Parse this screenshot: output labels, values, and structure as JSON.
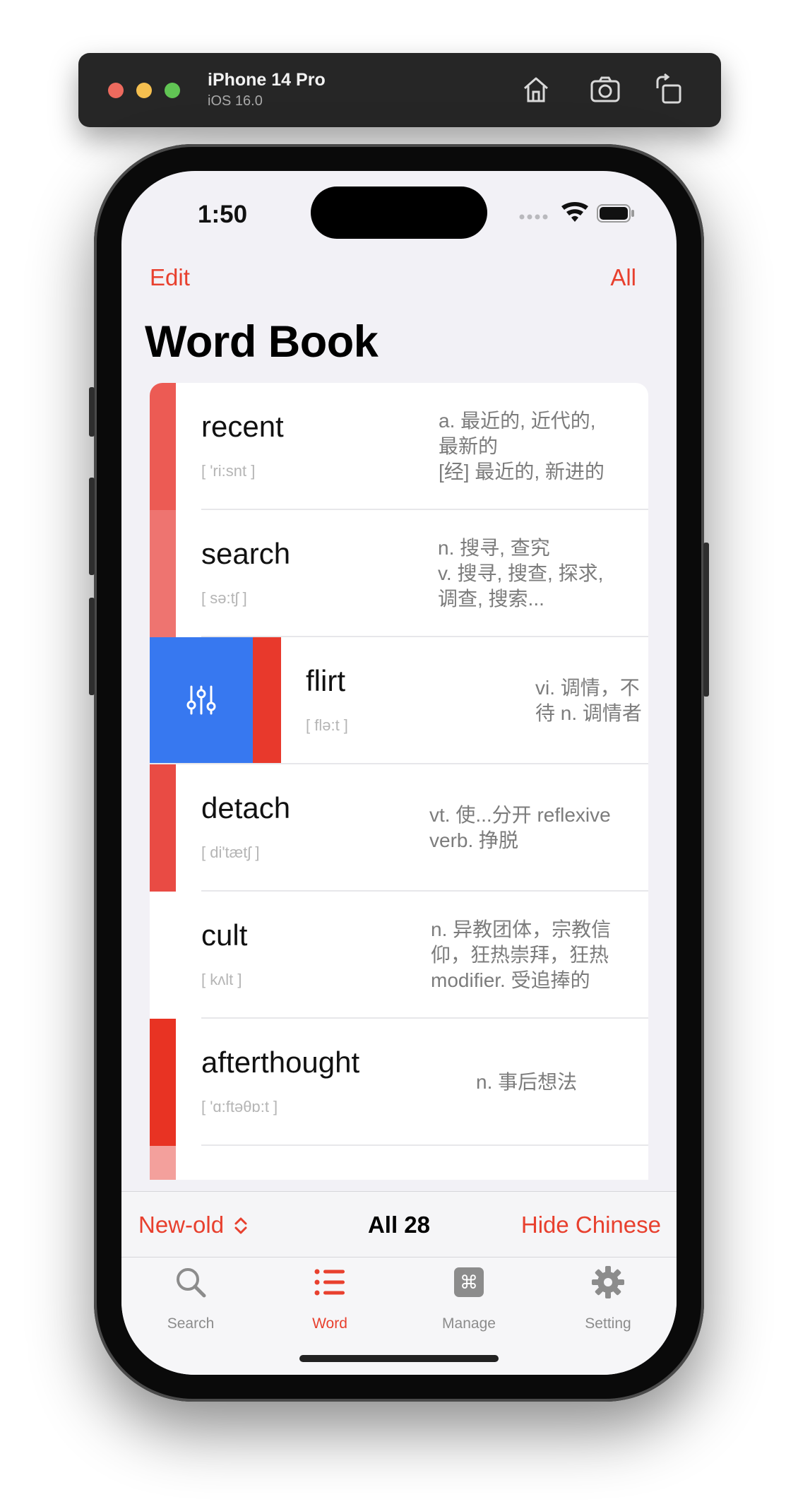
{
  "simulator": {
    "device_name": "iPhone 14 Pro",
    "os_version": "iOS 16.0"
  },
  "status_bar": {
    "time": "1:50"
  },
  "nav": {
    "edit_label": "Edit",
    "all_label": "All",
    "title": "Word Book"
  },
  "words": [
    {
      "word": "recent",
      "phonetic": "[ 'ri:snt ]",
      "meaning": "a. 最近的, 近代的,\n最新的\n[经] 最近的, 新进的",
      "color": "#ec5b54"
    },
    {
      "word": "search",
      "phonetic": "[ sə:tʃ ]",
      "meaning": "n. 搜寻, 查究\nv. 搜寻, 搜查, 探求,\n调查, 搜索...",
      "color": "#ee7470"
    },
    {
      "word": "flirt",
      "phonetic": "[ flə:t ]",
      "meaning": "vi. 调情，不\n待 n. 调情者",
      "color": "#e8392c"
    },
    {
      "word": "detach",
      "phonetic": "[ di'tætʃ ]",
      "meaning": "vt. 使...分开 reflexive\nverb. 挣脱",
      "color": "#e94b44"
    },
    {
      "word": "cult",
      "phonetic": "[ kʌlt ]",
      "meaning": "n. 异教团体，宗教信\n仰，狂热崇拜，狂热\nmodifier. 受追捧的",
      "color": "#ffffff"
    },
    {
      "word": "afterthought",
      "phonetic": "[ 'ɑ:ftəθɒ:t ]",
      "meaning": "n. 事后想法",
      "color": "#e83323"
    }
  ],
  "next_row_color": "#f3a09c",
  "swipe_action": {
    "icon": "sliders-icon",
    "color": "#3778f0"
  },
  "filter_bar": {
    "sort_label": "New-old",
    "count_label": "All 28",
    "hide_label": "Hide Chinese"
  },
  "tabs": [
    {
      "label": "Search",
      "icon": "search-icon",
      "active": false
    },
    {
      "label": "Word",
      "icon": "list-icon",
      "active": true
    },
    {
      "label": "Manage",
      "icon": "command-icon",
      "active": false
    },
    {
      "label": "Setting",
      "icon": "gear-icon",
      "active": false
    }
  ],
  "colors": {
    "accent": "#e8402e",
    "swipe": "#3778f0"
  }
}
